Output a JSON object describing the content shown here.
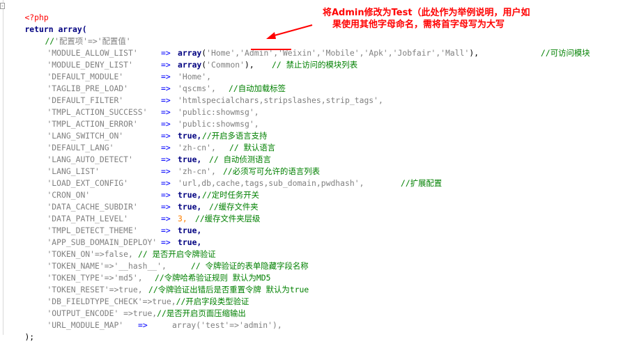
{
  "editor": {
    "lines": [
      "<?php",
      "return array(",
      "'配置项'=>'配置值'",
      "'MODULE_ALLOW_LIST'",
      "=>",
      "array('Home','Admin','Weixin','Mobile','Apk','Jobfair','Mall'),",
      "//可访问模块",
      "'MODULE_DENY_LIST'",
      "array('Common'),",
      "// 禁止访问的模块列表",
      "'DEFAULT_MODULE'",
      "'Home',",
      "'TAGLIB_PRE_LOAD'",
      "'qscms',",
      "//自动加载标签",
      "'DEFAULT_FILTER'",
      "'htmlspecialchars,stripslashes,strip_tags',",
      "'TMPL_ACTION_SUCCESS'",
      "'public:showmsg',",
      "'TMPL_ACTION_ERROR'",
      "'LANG_SWITCH_ON'",
      "true,",
      "//开启多语言支持",
      "'DEFAULT_LANG'",
      "'zh-cn',",
      "// 默认语言",
      "'LANG_AUTO_DETECT'",
      "// 自动侦测语言",
      "'LANG_LIST'",
      "//必须写可允许的语言列表",
      "'LOAD_EXT_CONFIG'",
      "'url,db,cache,tags,sub_domain,pwdhash',",
      "//扩展配置",
      "'CRON_ON'",
      "//定时任务开关",
      "'DATA_CACHE_SUBDIR'",
      "//缓存文件夹",
      "'DATA_PATH_LEVEL'",
      "3,",
      "//缓存文件夹层级",
      "'TMPL_DETECT_THEME'",
      "'APP_SUB_DOMAIN_DEPLOY'",
      "'TOKEN_ON'=>false,",
      "// 是否开启令牌验证",
      "'TOKEN_NAME'=>'__hash__',",
      "// 令牌验证的表单隐藏字段名称",
      "'TOKEN_TYPE'=>'md5',",
      "//令牌哈希验证规则 默认为MD5",
      "'TOKEN_RESET'=>true,",
      "//令牌验证出错后是否重置令牌 默认为true",
      "'DB_FIELDTYPE_CHECK'=>true,",
      "//开启字段类型验证",
      "'OUTPUT_ENCODE' =>true,",
      "//是否开启页面压缩输出",
      "'URL_MODULE_MAP'",
      "array('test'=>'admin'),",
      ");"
    ]
  },
  "annotation": {
    "line1": "将Admin修改为Test（此处作为举例说明，用户如",
    "line2": "果使用其他字母命名，需将首字母写为大写"
  },
  "colors": {
    "keyword": "#000080",
    "string": "#808080",
    "comment": "#008000",
    "number": "#ff8000",
    "annotation": "#ff0000"
  }
}
